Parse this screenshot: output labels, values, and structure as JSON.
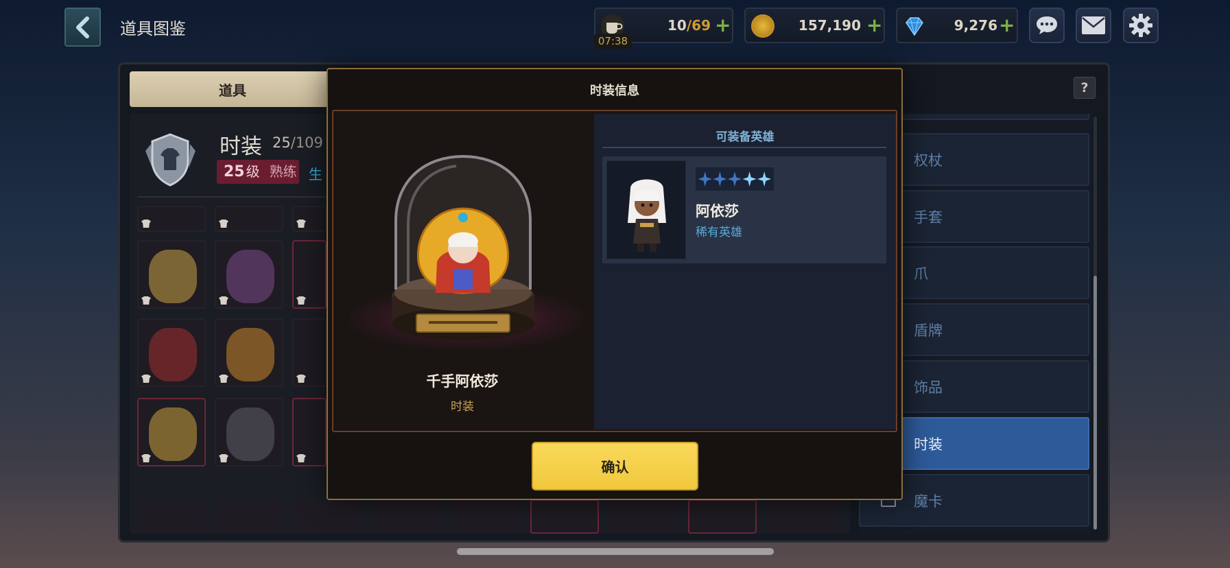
{
  "header": {
    "title": "道具图鉴",
    "stamina": {
      "current": "10",
      "max": "69",
      "timer": "07:38"
    },
    "gold": "157,190",
    "gems": "9,276"
  },
  "left_panel": {
    "tab_label": "道具",
    "category_title": "时装",
    "count_current": "25",
    "count_total": "/109",
    "level_value": "25",
    "level_unit": "级",
    "level_tag": "熟练",
    "extra_label": "生"
  },
  "sidebar": {
    "help": "?",
    "items": [
      {
        "label": "权杖",
        "active": false
      },
      {
        "label": "手套",
        "active": false
      },
      {
        "label": "爪",
        "active": false
      },
      {
        "label": "盾牌",
        "active": false
      },
      {
        "label": "饰品",
        "active": false
      },
      {
        "label": "时装",
        "active": true
      },
      {
        "label": "魔卡",
        "active": false
      }
    ]
  },
  "modal": {
    "title": "时装信息",
    "item_name": "千手阿依莎",
    "item_type": "时装",
    "hero_section_title": "可装备英雄",
    "hero": {
      "name": "阿依莎",
      "rarity": "稀有英雄",
      "stars": 5
    },
    "confirm_label": "确认"
  },
  "colors": {
    "accent_gold": "#f1c83d",
    "active_tab_blue": "#2d5a99",
    "rarity_blue": "#59a9d6"
  }
}
